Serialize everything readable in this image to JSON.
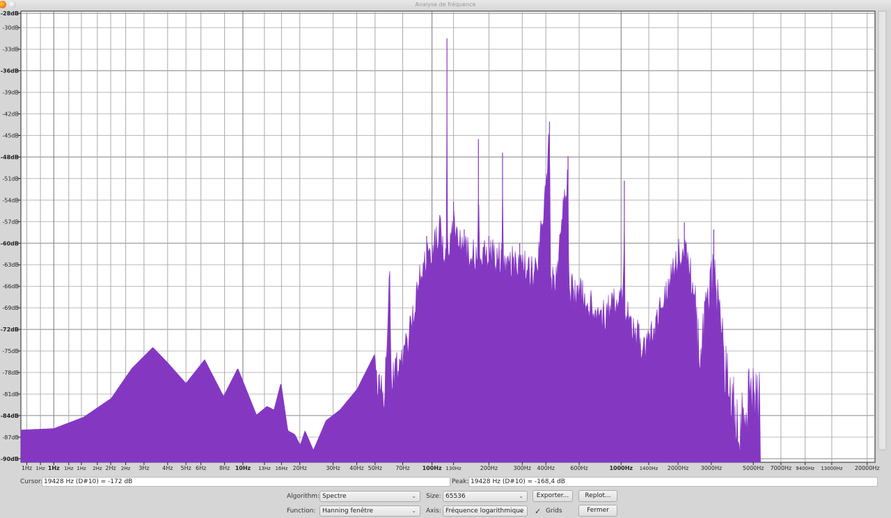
{
  "window": {
    "title": "Analyse de fréquence"
  },
  "chart_data": {
    "type": "area",
    "x_scale": "log",
    "xlim_hz": [
      0.67,
      22000
    ],
    "ylim_db": [
      -90.5,
      -27.7
    ],
    "grid": true,
    "y_ticks": [
      {
        "value": -28,
        "label": "-28dB",
        "bold": true
      },
      {
        "value": -30,
        "label": "-30dB"
      },
      {
        "value": -33,
        "label": "-33dB"
      },
      {
        "value": -36,
        "label": "-36dB",
        "bold": true
      },
      {
        "value": -39,
        "label": "-39dB"
      },
      {
        "value": -42,
        "label": "-42dB"
      },
      {
        "value": -45,
        "label": "-45dB"
      },
      {
        "value": -48,
        "label": "-48dB",
        "bold": true
      },
      {
        "value": -51,
        "label": "-51dB"
      },
      {
        "value": -54,
        "label": "-54dB"
      },
      {
        "value": -57,
        "label": "-57dB"
      },
      {
        "value": -60,
        "label": "-60dB",
        "bold": true
      },
      {
        "value": -63,
        "label": "-63dB"
      },
      {
        "value": -66,
        "label": "-66dB"
      },
      {
        "value": -69,
        "label": "-69dB"
      },
      {
        "value": -72,
        "label": "-72dB",
        "bold": true
      },
      {
        "value": -75,
        "label": "-75dB"
      },
      {
        "value": -78,
        "label": "-78dB"
      },
      {
        "value": -81,
        "label": "-81dB"
      },
      {
        "value": -84,
        "label": "-84dB",
        "bold": true
      },
      {
        "value": -87,
        "label": "-87dB"
      },
      {
        "value": -90,
        "label": "-90dB",
        "bold": true
      }
    ],
    "x_ticks": [
      {
        "value": 0.72,
        "label": "1Hz"
      },
      {
        "value": 0.85,
        "label": "1Hz",
        "minor": true
      },
      {
        "value": 1,
        "label": "1Hz",
        "bold": true
      },
      {
        "value": 1.2,
        "label": "1Hz",
        "minor": true
      },
      {
        "value": 1.4,
        "label": "1Hz",
        "minor": true
      },
      {
        "value": 1.7,
        "label": "2Hz",
        "minor": true
      },
      {
        "value": 2,
        "label": "2Hz"
      },
      {
        "value": 2.4,
        "label": "2Hz",
        "minor": true
      },
      {
        "value": 3,
        "label": "3Hz"
      },
      {
        "value": 4,
        "label": "4Hz"
      },
      {
        "value": 5,
        "label": "5Hz"
      },
      {
        "value": 6,
        "label": "6Hz"
      },
      {
        "value": 8,
        "label": "8Hz"
      },
      {
        "value": 10,
        "label": "10Hz",
        "bold": true
      },
      {
        "value": 13,
        "label": "13Hz",
        "minor": true
      },
      {
        "value": 16,
        "label": "16Hz",
        "minor": true
      },
      {
        "value": 20,
        "label": "20Hz"
      },
      {
        "value": 30,
        "label": "30Hz"
      },
      {
        "value": 40,
        "label": "40Hz"
      },
      {
        "value": 50,
        "label": "50Hz"
      },
      {
        "value": 70,
        "label": "70Hz"
      },
      {
        "value": 100,
        "label": "100Hz",
        "bold": true
      },
      {
        "value": 130,
        "label": "130Hz",
        "minor": true
      },
      {
        "value": 200,
        "label": "200Hz"
      },
      {
        "value": 300,
        "label": "300Hz"
      },
      {
        "value": 400,
        "label": "400Hz"
      },
      {
        "value": 600,
        "label": "600Hz"
      },
      {
        "value": 1000,
        "label": "1000Hz",
        "bold": true
      },
      {
        "value": 1400,
        "label": "1400Hz",
        "minor": true
      },
      {
        "value": 2000,
        "label": "2000Hz"
      },
      {
        "value": 3000,
        "label": "3000Hz"
      },
      {
        "value": 5000,
        "label": "5000Hz"
      },
      {
        "value": 7000,
        "label": "7000Hz"
      },
      {
        "value": 9400,
        "label": "9400Hz",
        "minor": true
      },
      {
        "value": 13000,
        "label": "13000Hz",
        "minor": true
      },
      {
        "value": 20000,
        "label": "20000Hz"
      }
    ],
    "series": [
      {
        "color": "#8438c2",
        "points": [
          [
            0.67,
            -86
          ],
          [
            1,
            -85.8
          ],
          [
            1.44,
            -84.2
          ],
          [
            2.01,
            -81.6
          ],
          [
            2.59,
            -77.4
          ],
          [
            3.34,
            -74.5
          ],
          [
            3.96,
            -76.5
          ],
          [
            5.0,
            -79.5
          ],
          [
            6.28,
            -76.2
          ],
          [
            7.9,
            -81.3
          ],
          [
            9.4,
            -77.4
          ],
          [
            11.8,
            -83.9
          ],
          [
            13.4,
            -82.7
          ],
          [
            14.6,
            -83.2
          ],
          [
            15.9,
            -79.4
          ],
          [
            17.3,
            -86.1
          ],
          [
            18.8,
            -86.6
          ],
          [
            20.1,
            -88.1
          ],
          [
            21.3,
            -86.1
          ],
          [
            23.6,
            -88.8
          ],
          [
            27.5,
            -84.7
          ],
          [
            32.6,
            -83.2
          ],
          [
            40.2,
            -80.3
          ],
          [
            49.6,
            -75.5
          ],
          [
            56.3,
            -78.4
          ],
          [
            59.7,
            -62.4
          ],
          [
            61,
            -76
          ],
          [
            66.5,
            -74.5
          ],
          [
            75.9,
            -70.6
          ],
          [
            82.5,
            -64.4
          ],
          [
            93.7,
            -59
          ],
          [
            110,
            -56.1
          ],
          [
            119,
            -60
          ],
          [
            120,
            -31.5
          ],
          [
            121,
            -60
          ],
          [
            130,
            -54.2
          ],
          [
            148,
            -58.1
          ],
          [
            175,
            -60
          ],
          [
            176,
            -45.5
          ],
          [
            178,
            -60
          ],
          [
            200,
            -59
          ],
          [
            234,
            -60
          ],
          [
            236,
            -47.4
          ],
          [
            238,
            -60
          ],
          [
            291,
            -60
          ],
          [
            360,
            -62
          ],
          [
            418,
            -43.1
          ],
          [
            425,
            -62.9
          ],
          [
            445,
            -62.9
          ],
          [
            524,
            -47.9
          ],
          [
            530,
            -64
          ],
          [
            624,
            -64.8
          ],
          [
            800,
            -67.7
          ],
          [
            1030,
            -64
          ],
          [
            1040,
            -51.3
          ],
          [
            1050,
            -66
          ],
          [
            1330,
            -72.6
          ],
          [
            1700,
            -64.8
          ],
          [
            2160,
            -57.1
          ],
          [
            2620,
            -69.7
          ],
          [
            3090,
            -58.1
          ],
          [
            3660,
            -75.5
          ],
          [
            4330,
            -80.3
          ],
          [
            4900,
            -76.4
          ],
          [
            5440,
            -77.4
          ],
          [
            5460,
            -90.5
          ]
        ]
      }
    ]
  },
  "cursor": {
    "label": "Cursor:",
    "value": "19428 Hz (D#10) = -172 dB"
  },
  "peak": {
    "label": "Peak:",
    "value": "19428 Hz (D#10) = -168,4 dB"
  },
  "controls": {
    "algorithm": {
      "label": "Algorithm:",
      "value": "Spectre"
    },
    "size": {
      "label": "Size:",
      "value": "65536"
    },
    "function": {
      "label": "Function:",
      "value": "Hanning fenêtre"
    },
    "axis": {
      "label": "Axis:",
      "value": "Fréquence logarithmique"
    },
    "grids": {
      "label": "Grids",
      "checked": true
    },
    "export_label": "Exporter...",
    "replot_label": "Replot...",
    "close_label": "Fermer"
  }
}
